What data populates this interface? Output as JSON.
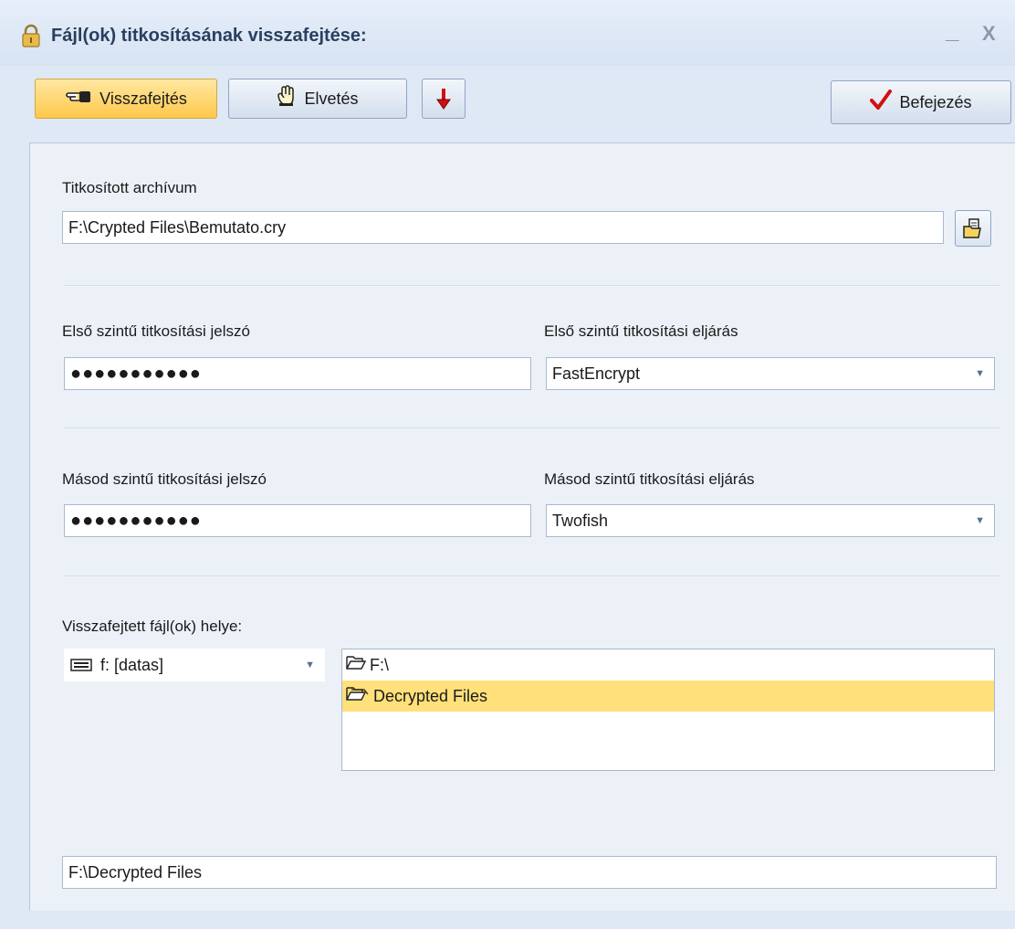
{
  "window": {
    "title": "Fájl(ok) titkosításának visszafejtése:",
    "minimize_glyph": "_",
    "close_glyph": "X"
  },
  "toolbar": {
    "decrypt_label": "Visszafejtés",
    "discard_label": "Elvetés",
    "finish_label": "Befejezés"
  },
  "archive": {
    "label": "Titkosított archívum",
    "path": "F:\\Crypted Files\\Bemutato.cry"
  },
  "level1": {
    "password_label": "Első szintű titkosítási jelszó",
    "password_value": "●●●●●●●●●●●",
    "method_label": "Első szintű titkosítási eljárás",
    "method_value": "FastEncrypt"
  },
  "level2": {
    "password_label": "Másod szintű titkosítási jelszó",
    "password_value": "●●●●●●●●●●●",
    "method_label": "Másod szintű titkosítási eljárás",
    "method_value": "Twofish"
  },
  "output": {
    "label": "Visszafejtett fájl(ok) helye:",
    "drive": "f: [datas]",
    "folders": [
      {
        "name": "F:\\",
        "selected": false
      },
      {
        "name": "Decrypted Files",
        "selected": true
      }
    ],
    "path": "F:\\Decrypted Files"
  },
  "colors": {
    "accent_active": "#ffc84a",
    "selection": "#ffe07a",
    "panel": "#ecf1f8"
  }
}
